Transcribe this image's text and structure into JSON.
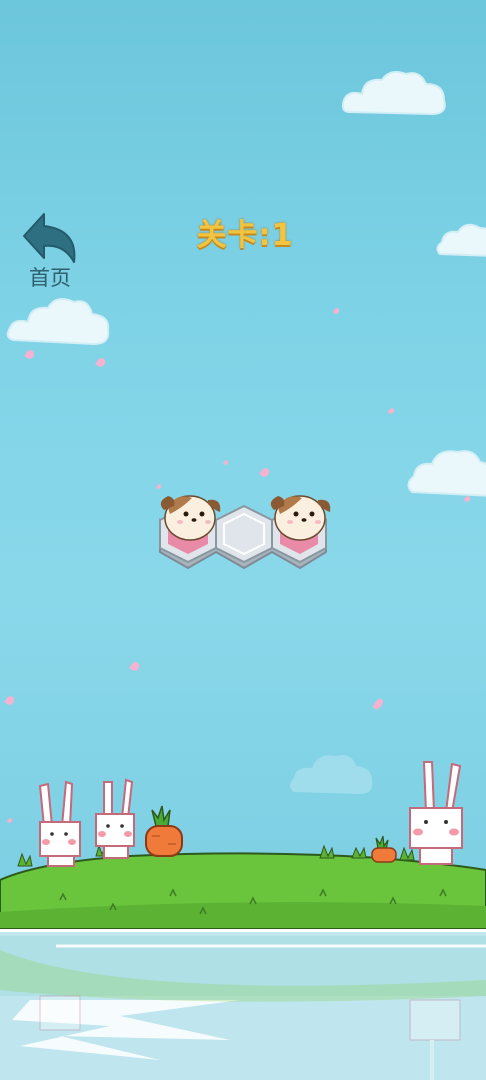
{
  "header": {
    "back_label": "首页",
    "level_label": "关卡:",
    "level_number": "1"
  },
  "board": {
    "cells": [
      {
        "occupant": "puppy"
      },
      {
        "occupant": "empty-target"
      },
      {
        "occupant": "puppy"
      }
    ]
  },
  "colors": {
    "sky": "#7fd3e6",
    "title_gold": "#f3c440",
    "back_teal": "#2f6f82",
    "grass": "#6ac43c",
    "water": "#bfe6ee"
  },
  "decor": {
    "rabbits": 3,
    "carrots": 2
  }
}
